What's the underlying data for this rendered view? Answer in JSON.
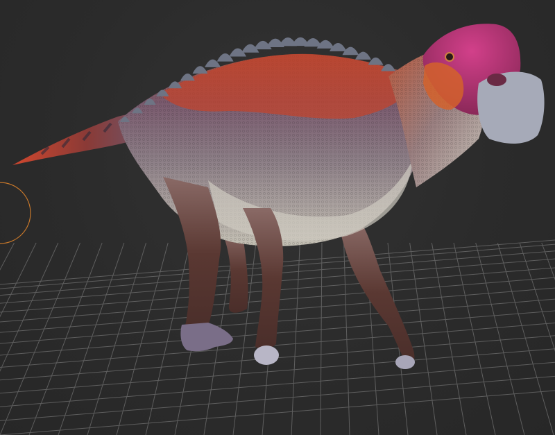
{
  "viewport": {
    "background_color": "#2b2b2b",
    "grid_color": "#8a8a8a",
    "gizmo_color": "#c8782a"
  },
  "model": {
    "subject": "hadrosaur-dinosaur",
    "colors": {
      "head_crest": "#b0306a",
      "back_stripe": "#c2442e",
      "body": "#8a6e7e",
      "belly": "#bfbcb0",
      "legs": "#5e3b34",
      "beak": "#a6aab8",
      "spikes": "#6e7484"
    }
  },
  "icons": {
    "gizmo": "orbit-ring-icon"
  }
}
